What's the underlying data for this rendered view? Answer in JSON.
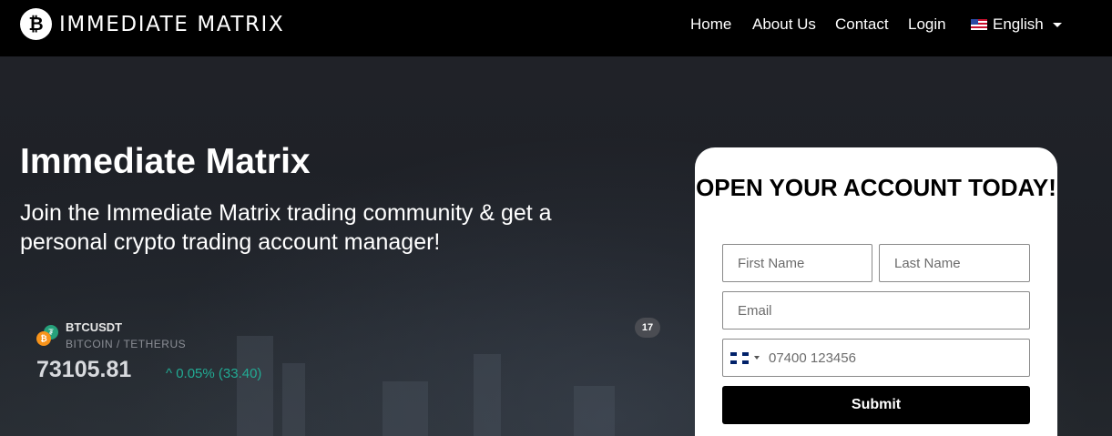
{
  "header": {
    "logo_text": "IMMEDIATE MATRIX",
    "logo_symbol": "₿",
    "nav": [
      "Home",
      "About Us",
      "Contact",
      "Login"
    ],
    "language": "English"
  },
  "hero": {
    "title": "Immediate Matrix",
    "subtitle": "Join the Immediate Matrix trading community & get a personal crypto trading account manager!"
  },
  "ticker": {
    "symbol": "BTCUSDT",
    "name": "BITCOIN / TETHERUS",
    "price": "73105.81",
    "change": "^ 0.05% (33.40)",
    "badge": "17"
  },
  "form": {
    "title": "OPEN YOUR ACCOUNT TODAY!",
    "first_name_placeholder": "First Name",
    "last_name_placeholder": "Last Name",
    "email_placeholder": "Email",
    "phone_placeholder": "07400 123456",
    "submit_label": "Submit"
  },
  "colors": {
    "header_bg": "#000000",
    "hero_bg": "#1d2026",
    "ticker_up": "#22ab94",
    "button_bg": "#000000"
  }
}
